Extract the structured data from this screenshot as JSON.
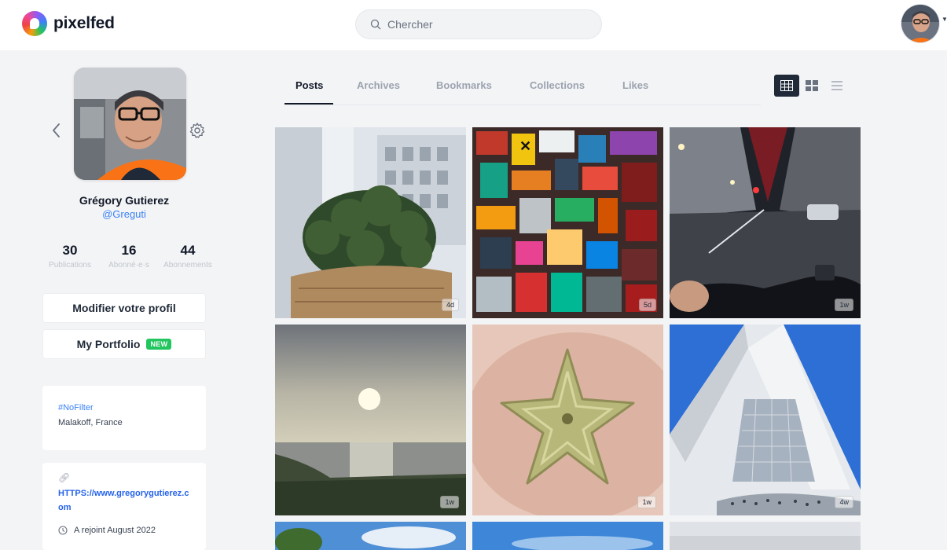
{
  "app": {
    "name": "pixelfed"
  },
  "search": {
    "placeholder": "Chercher"
  },
  "profile": {
    "name": "Grégory Gutierez",
    "handle": "@Greguti",
    "stats": [
      {
        "value": "30",
        "label": "Publications"
      },
      {
        "value": "16",
        "label": "Abonné·e·s"
      },
      {
        "value": "44",
        "label": "Abonnements"
      }
    ],
    "edit_label": "Modifier votre profil",
    "portfolio_label": "My Portfolio",
    "portfolio_badge": "NEW",
    "tag": "#NoFilter",
    "location": "Malakoff, France",
    "website": "HTTPS://www.gregorygutierez.com",
    "joined": "A rejoint August 2022"
  },
  "tabs": [
    {
      "label": "Posts",
      "active": true
    },
    {
      "label": "Archives",
      "active": false
    },
    {
      "label": "Bookmarks",
      "active": false
    },
    {
      "label": "Collections",
      "active": false
    },
    {
      "label": "Likes",
      "active": false
    }
  ],
  "view_modes": [
    "grid-3-icon",
    "grid-2-icon",
    "list-icon"
  ],
  "posts": [
    {
      "subject": "cactus",
      "age": "4d"
    },
    {
      "subject": "stickers",
      "age": "5d"
    },
    {
      "subject": "night-street",
      "age": "1w"
    },
    {
      "subject": "sea-sunset",
      "age": "1w"
    },
    {
      "subject": "starfish",
      "age": "1w"
    },
    {
      "subject": "grande-arche",
      "age": "4w"
    }
  ],
  "colors": {
    "accent": "#3b82f6",
    "badge_new": "#22c55e",
    "text": "#111827"
  }
}
